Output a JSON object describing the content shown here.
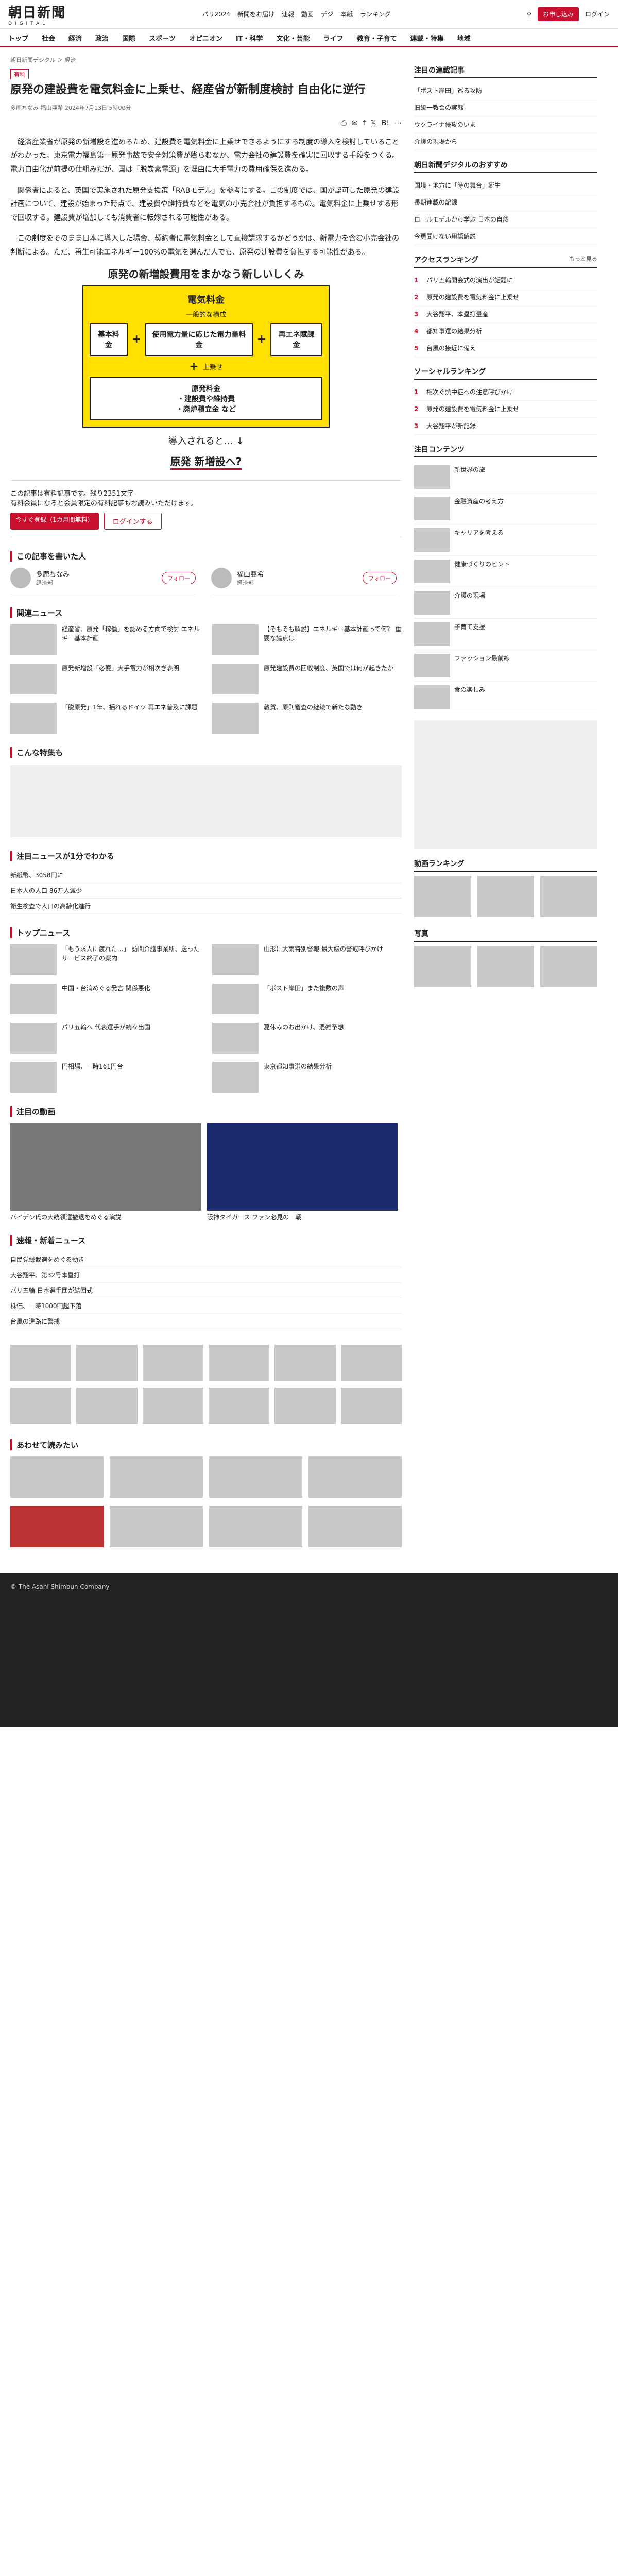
{
  "header": {
    "logo": "朝日新聞",
    "logo_sub": "DIGITAL",
    "links": [
      "パリ2024",
      "新聞をお届け",
      "速報",
      "動画",
      "デジ",
      "本紙",
      "ランキング"
    ],
    "subscribe": "お申し込み",
    "login": "ログイン"
  },
  "nav": [
    "トップ",
    "社会",
    "経済",
    "政治",
    "国際",
    "スポーツ",
    "オピニオン",
    "IT・科学",
    "文化・芸能",
    "ライフ",
    "教育・子育て",
    "連載・特集",
    "地域"
  ],
  "breadcrumb": "朝日新聞デジタル ＞ 経済",
  "article": {
    "tag": "有料",
    "title": "原発の建設費を電気料金に上乗せ、経産省が新制度検討 自由化に逆行",
    "author_meta": "多鹿ちなみ 福山亜希 2024年7月13日 5時00分",
    "paragraphs": [
      "経済産業省が原発の新増設を進めるため、建設費を電気料金に上乗せできるようにする制度の導入を検討していることがわかった。東京電力福島第一原発事故で安全対策費が膨らむなか、電力会社の建設費を確実に回収する手段をつくる。電力自由化が前提の仕組みだが、国は「脱炭素電源」を理由に大手電力の費用確保を進める。",
      "関係者によると、英国で実施された原発支援策「RABモデル」を参考にする。この制度では、国が認可した原発の建設計画について、建設が始まった時点で、建設費や維持費などを電気の小売会社が負担するもの。電気料金に上乗せする形で回収する。建設費が増加しても消費者に転嫁される可能性がある。",
      "この制度をそのまま日本に導入した場合、契約者に電気料金として直接請求するかどうかは、新電力を含む小売会社の判断による。ただ、再生可能エネルギー100%の電気を選んだ人でも、原発の建設費を負担する可能性がある。"
    ],
    "figure": {
      "title": "原発の新増設費用をまかなう新しいしくみ",
      "box1_title": "電気料金",
      "box1_sub": "一般的な構成",
      "cells": [
        "基本料金",
        "使用電力量に応じた電力量料金",
        "再エネ賦課金"
      ],
      "plus_note": "上乗せ",
      "box2_title": "原発料金",
      "box2_lines": [
        "・建設費や維持費",
        "・廃炉積立金 など"
      ],
      "arrow_note": "導入されると…",
      "result": "原発 新増設へ?"
    },
    "paywall": "この記事は有料記事です。残り2351文字",
    "paywall_note": "有料会員になると会員限定の有料記事もお読みいただけます。",
    "trial_button": "今すぐ登録（1カ月間無料）",
    "login_button": "ログインする"
  },
  "authors_title": "この記事を書いた人",
  "authors": [
    {
      "name": "多鹿ちなみ",
      "desc": "経済部",
      "follow": "フォロー"
    },
    {
      "name": "福山亜希",
      "desc": "経済部",
      "follow": "フォロー"
    }
  ],
  "related_title": "関連ニュース",
  "related": [
    "経産省、原発「稼働」を認める方向で検討 エネルギー基本計画",
    "【そもそも解説】エネルギー基本計画って何？ 重要な論点は",
    "原発新増設「必要」大手電力が相次ぎ表明",
    "原発建設費の回収制度、英国では何が起きたか",
    "「脱原発」1年、揺れるドイツ 再エネ普及に課題",
    "敦賀、原則審査の継続で新たな動き"
  ],
  "feature_title": "こんな特集も",
  "weekly_title": "注目ニュースが1分でわかる",
  "weekly_items": [
    "新紙幣、3058円に",
    "日本人の人口 86万人減少",
    "衛生検査で人口の高齢化進行"
  ],
  "top_news_title": "トップニュース",
  "top_news": [
    "「もう求人に疲れた…」 訪問介護事業所、送ったサービス終了の案内",
    "山形に大雨特別警報 最大級の警戒呼びかけ",
    "中国・台湾めぐる発言 関係悪化",
    "「ポスト岸田」また複数の声",
    "パリ五輪へ 代表選手が続々出国",
    "夏休みのお出かけ、混雑予想",
    "円相場、一時161円台",
    "東京都知事選の結果分析"
  ],
  "video_title": "注目の動画",
  "video_items": [
    "バイデン氏の大統領選撤退をめぐる演説",
    "阪神タイガース ファン必見の一戦"
  ],
  "breaking_title": "速報・新着ニュース",
  "breaking": [
    "自民党総裁選をめぐる動き",
    "大谷翔平、第32号本塁打",
    "パリ五輪 日本選手団が結団式",
    "株価、一時1000円超下落",
    "台風の進路に警戒"
  ],
  "bottom_title": "あわせて読みたい",
  "sidebar": {
    "serial_title": "注目の連載記事",
    "serial_items": [
      "「ポスト岸田」巡る攻防",
      "旧統一教会の実態",
      "ウクライナ侵攻のいま",
      "介護の現場から"
    ],
    "popular_title": "朝日新聞デジタルのおすすめ",
    "popular_items": [
      "国境・地方に「時の舞台」誕生",
      "長期連載の記録",
      "ロールモデルから学ぶ 日本の自然",
      "今更聞けない用語解説"
    ],
    "ranking_title": "アクセスランキング",
    "ranking_more": "もっと見る",
    "ranking_items": [
      "パリ五輪開会式の演出が話題に",
      "原発の建設費を電気料金に上乗せ",
      "大谷翔平、本塁打量産",
      "都知事選の結果分析",
      "台風の接近に備え"
    ],
    "social_title": "ソーシャルランキング",
    "social_items": [
      "相次ぐ熱中症への注意呼びかけ",
      "原発の建設費を電気料金に上乗せ",
      "大谷翔平が新記録"
    ],
    "content_title": "注目コンテンツ",
    "content_items": [
      "新世界の旅",
      "金融資産の考え方",
      "キャリアを考える",
      "健康づくりのヒント",
      "介護の現場",
      "子育て支援",
      "ファッション最前線",
      "食の楽しみ"
    ],
    "video_rank_title": "動画ランキング",
    "photo_title": "写真"
  },
  "footer": "© The Asahi Shimbun Company"
}
